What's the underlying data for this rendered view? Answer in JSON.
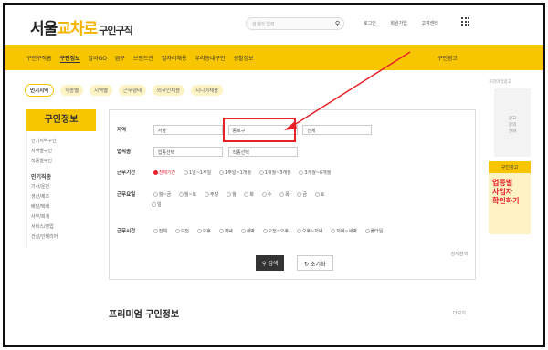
{
  "brand": {
    "prefix": "서울",
    "highlight": "교차로",
    "suffix": "구인구직"
  },
  "search": {
    "placeholder": "검색어 입력"
  },
  "top_links": [
    "로그인",
    "회원가입",
    "고객센터"
  ],
  "nav": {
    "items": [
      "구인구직홈",
      "구인정보",
      "알바GO",
      "급구",
      "브랜드관",
      "일자리채용",
      "우리동네구인",
      "생활정보"
    ],
    "active_index": 1,
    "right_label": "구인광고"
  },
  "subtabs": [
    "인기지역",
    "직종별",
    "지역별",
    "근무형태",
    "외국인채용",
    "시니어채용"
  ],
  "sidebar": {
    "title": "구인정보",
    "links": [
      "인기지역구인",
      "지역별구인",
      "직종별구인"
    ],
    "section_title": "인기직종",
    "section_links": [
      "기사/운전",
      "생산/제조",
      "배달/택배",
      "사무/회계",
      "서비스/영업",
      "건설/인테리어"
    ]
  },
  "form": {
    "region_label": "지역",
    "region_values": [
      "서울",
      "종로구",
      "전체"
    ],
    "job_label": "업직종",
    "job_values": [
      "업종선택",
      "직종선택"
    ],
    "period_label": "근무기간",
    "period_options": [
      "전체기간",
      "1일~1주일",
      "1주일~1개월",
      "1개월~3개월",
      "3개월~6개월",
      "6개월~1년",
      "1년이상"
    ],
    "day_label": "근무요일",
    "day_options": [
      "월~금",
      "월~토",
      "주말",
      "월",
      "화",
      "수",
      "목",
      "금",
      "토",
      "일"
    ],
    "time_label": "근무시간",
    "time_options": [
      "전체",
      "오전",
      "오후",
      "저녁",
      "새벽",
      "오전~오후",
      "오후~저녁",
      "저녁~새벽",
      "새벽~오전",
      "풀타임"
    ],
    "more_label": "상세검색",
    "search_button": "검색",
    "reset_button": "초기화"
  },
  "premium": {
    "title": "프리미엄 구인정보",
    "more": "더보기"
  },
  "ads": {
    "label": "프리미엄광고",
    "placeholder_lines": [
      "광고",
      "문의",
      "전화"
    ],
    "banner_head": "구인광고",
    "banner_lines": [
      "업종별",
      "사업자",
      "확인하기"
    ]
  },
  "colors": {
    "accent": "#f8c600",
    "highlight": "#e8202a"
  }
}
